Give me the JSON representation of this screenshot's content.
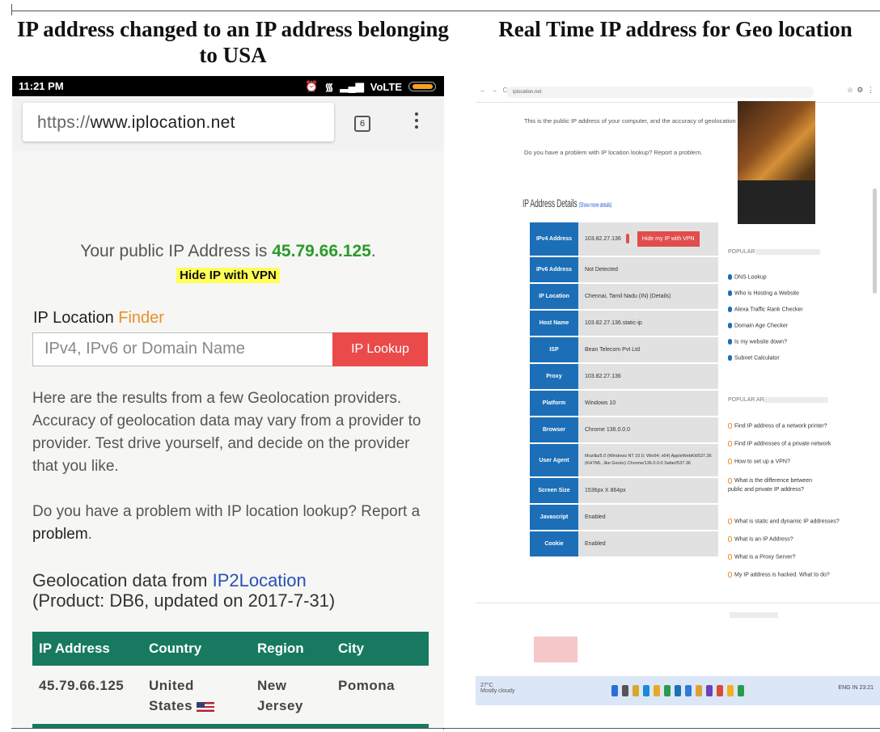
{
  "captions": {
    "left": "IP address changed to an IP address belonging to USA",
    "right": "Real Time IP address for Geo location"
  },
  "phone": {
    "status": {
      "time": "11:21 PM",
      "network": "VoLTE"
    },
    "url": {
      "scheme": "https://",
      "host": "www.iplocation.net"
    },
    "tab_count": "6",
    "ip_prefix": "Your public IP Address is ",
    "ip_value": "45.79.66.125",
    "ip_suffix": ".",
    "vpn_label": "Hide IP with VPN",
    "finder_title_a": "IP Location ",
    "finder_title_b": "Finder",
    "input_placeholder": "IPv4, IPv6 or Domain Name",
    "lookup_label": "IP Lookup",
    "para1": "Here are the results from a few Geolocation providers. Accuracy of geolocation data may vary from a provider to provider. Test drive yourself, and decide on the provider that you like.",
    "para2_a": "Do you have a problem with IP location lookup? Report a ",
    "para2_link": "problem",
    "para2_b": ".",
    "geo_title_a": "Geolocation data from ",
    "geo_title_link": "IP2Location",
    "geo_title_b": "(Product: DB6, updated on 2017-7-31)",
    "table": {
      "headers": [
        "IP Address",
        "Country",
        "Region",
        "City"
      ],
      "row": {
        "ip": "45.79.66.125",
        "country_a": "United",
        "country_b": "States",
        "region_a": "New",
        "region_b": "Jersey",
        "city": "Pomona"
      }
    },
    "colors": {
      "ip": "#2a9b2a",
      "header": "#177a60",
      "lookup": "#ea4a4a",
      "vpn": "#ffff55"
    }
  },
  "desktop": {
    "url": "iplocation.net",
    "intro1": "This is the public IP address of your computer, and the accuracy of geolocation may vary.",
    "intro2": "Do you have a problem with IP location lookup? Report a problem.",
    "details_title": "IP Address Details",
    "details_more": "(Show more details)",
    "rows": [
      {
        "k": "IPv4 Address",
        "v": "103.82.27.136"
      },
      {
        "k": "IPv6 Address",
        "v": "Not Detected"
      },
      {
        "k": "IP Location",
        "v": "Chennai, Tamil Nadu (IN) (Details)"
      },
      {
        "k": "Host Name",
        "v": "103.82.27.136.static-ip"
      },
      {
        "k": "ISP",
        "v": "Bean Telecom Pvt Ltd"
      },
      {
        "k": "Proxy",
        "v": "103.82.27.136"
      },
      {
        "k": "Platform",
        "v": "Windows 10"
      },
      {
        "k": "Browser",
        "v": "Chrome 136.0.0.0"
      },
      {
        "k": "User Agent",
        "v": "Mozilla/5.0 (Windows NT 10.0; Win64; x64) AppleWebKit/537.36 (KHTML, like Gecko) Chrome/136.0.0.0 Safari/537.36"
      },
      {
        "k": "Screen Size",
        "v": "1536px X 864px"
      },
      {
        "k": "Javascript",
        "v": "Enabled"
      },
      {
        "k": "Cookie",
        "v": "Enabled"
      }
    ],
    "vpn_label": "Hide my IP with VPN",
    "tools_head": "POPULAR TOOLS",
    "tools": [
      "DNS Lookup",
      "Who is Hosting a Website",
      "Alexa Traffic Rank Checker",
      "Domain Age Checker",
      "Is my website down?",
      "Subnet Calculator"
    ],
    "articles_head": "POPULAR ARTICLES",
    "articles": [
      "Find IP address of a network printer?",
      "Find IP addresses of a private network",
      "How to set up a VPN?",
      "What is the difference between public and private IP address?",
      "What is static and dynamic IP addresses?",
      "What is an IP Address?",
      "What is a Proxy Server?",
      "My IP address is hacked. What to do?"
    ],
    "weather": "27°C",
    "weather_sub": "Mostly cloudy",
    "tray": "ENG IN 23:21"
  }
}
